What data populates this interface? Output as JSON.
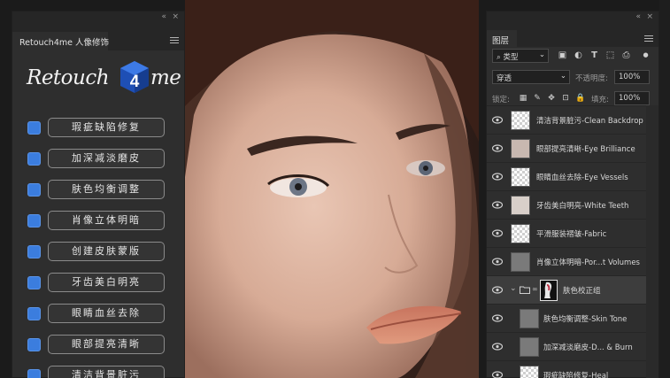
{
  "left_panel": {
    "tab_label": "Retouch4me 人像修饰",
    "collapse_glyph": "«",
    "close_glyph": "×",
    "logo": {
      "text_before": "Retouch",
      "cube_digit": "4",
      "text_after": "me"
    },
    "tools": [
      {
        "label": "瑕疵缺陷修复",
        "checked": true
      },
      {
        "label": "加深减淡磨皮",
        "checked": true
      },
      {
        "label": "肤色均衡调整",
        "checked": true
      },
      {
        "label": "肖像立体明暗",
        "checked": true
      },
      {
        "label": "创建皮肤蒙版",
        "checked": true
      },
      {
        "label": "牙齿美白明亮",
        "checked": true
      },
      {
        "label": "眼睛血丝去除",
        "checked": true
      },
      {
        "label": "眼部提亮清晰",
        "checked": true
      },
      {
        "label": "清洁背景脏污",
        "checked": true
      }
    ]
  },
  "right_panel": {
    "tab_label": "图层",
    "collapse_glyph": "«",
    "close_glyph": "×",
    "filter_kind": "类型",
    "blend_mode": "穿透",
    "opacity_label": "不透明度:",
    "opacity_value": "100%",
    "lock_label": "锁定:",
    "fill_label": "填充:",
    "fill_value": "100%",
    "layers": [
      {
        "name": "清洁背景脏污-Clean Backdrop",
        "thumb": "trans",
        "indent": false
      },
      {
        "name": "眼部提亮清晰-Eye Brilliance",
        "thumb": "eyes",
        "indent": false
      },
      {
        "name": "眼睛血丝去除-Eye Vessels",
        "thumb": "trans",
        "indent": false
      },
      {
        "name": "牙齿美白明亮-White Teeth",
        "thumb": "teeth",
        "indent": false
      },
      {
        "name": "平滑服装褶皱-Fabric",
        "thumb": "trans",
        "indent": false
      },
      {
        "name": "肖像立体明暗-Por...t Volumes",
        "thumb": "gray",
        "indent": false
      },
      {
        "name": "肤色校正组",
        "thumb": "group",
        "indent": false
      },
      {
        "name": "肤色均衡调整-Skin Tone",
        "thumb": "gray",
        "indent": true
      },
      {
        "name": "加深减淡磨皮-D... & Burn",
        "thumb": "gray",
        "indent": true
      },
      {
        "name": "瑕疵缺陷修复-Heal",
        "thumb": "trans",
        "indent": true
      }
    ]
  },
  "colors": {
    "accent_blue": "#3b7dde",
    "panel_bg": "#2e2e2e",
    "logo_cube": "#2a5fc8"
  }
}
